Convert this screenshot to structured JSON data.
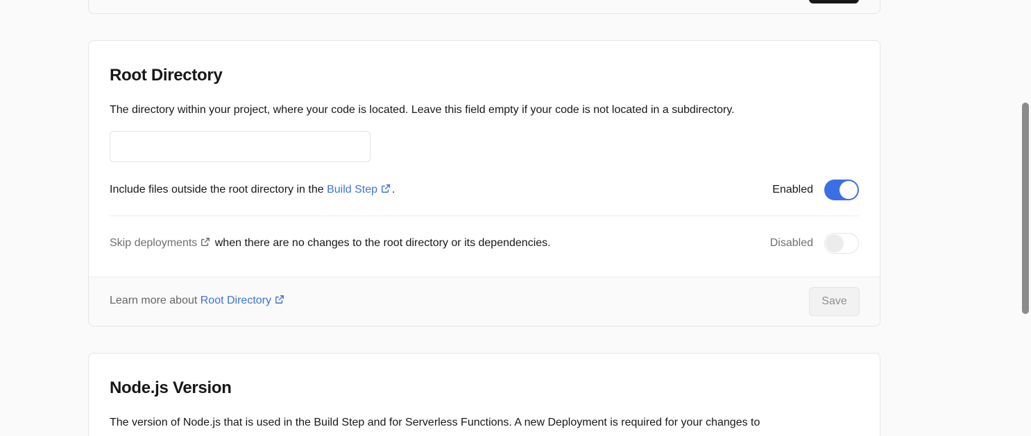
{
  "root_directory": {
    "title": "Root Directory",
    "description": "The directory within your project, where your code is located. Leave this field empty if your code is not located in a subdirectory.",
    "input_value": "",
    "include_files": {
      "text_before": "Include files outside the root directory in the ",
      "link_text": "Build Step",
      "text_after": ".",
      "status_label": "Enabled",
      "enabled": true
    },
    "skip_deployments": {
      "link_text": "Skip deployments",
      "text_after": " when there are no changes to the root directory or its dependencies.",
      "status_label": "Disabled",
      "enabled": false
    },
    "footer": {
      "learn_more_text": "Learn more about ",
      "link_text": "Root Directory",
      "save_label": "Save"
    }
  },
  "node_version": {
    "title": "Node.js Version",
    "description": "The version of Node.js that is used in the Build Step and for Serverless Functions. A new Deployment is required for your changes to"
  },
  "icons": {
    "external_link": "external-link-icon"
  },
  "colors": {
    "accent": "#3b6fe6",
    "link": "#3b73e0",
    "background": "#fafafa"
  }
}
